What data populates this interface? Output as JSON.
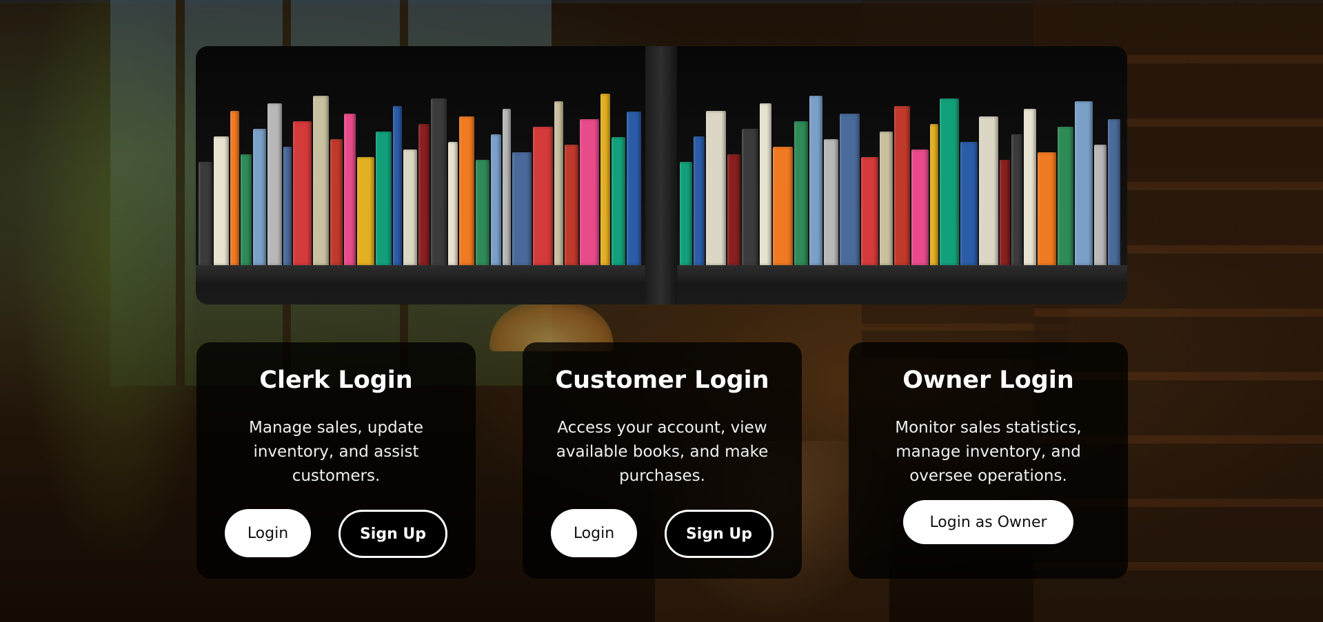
{
  "colors": {
    "card_background": "#000000",
    "button_primary": "#ffffff",
    "button_text_dark": "#111111",
    "text_light": "#ffffff"
  },
  "hero": {
    "image_description_icon": "bookshelf-banner-icon"
  },
  "cards": {
    "clerk": {
      "title": "Clerk Login",
      "description": "Manage sales, update inventory, and assist customers.",
      "login_label": "Login",
      "signup_label": "Sign Up"
    },
    "customer": {
      "title": "Customer Login",
      "description": "Access your account, view available books, and make purchases.",
      "login_label": "Login",
      "signup_label": "Sign Up"
    },
    "owner": {
      "title": "Owner Login",
      "description": "Monitor sales statistics, manage inventory, and oversee operations.",
      "login_label": "Login as Owner"
    }
  }
}
